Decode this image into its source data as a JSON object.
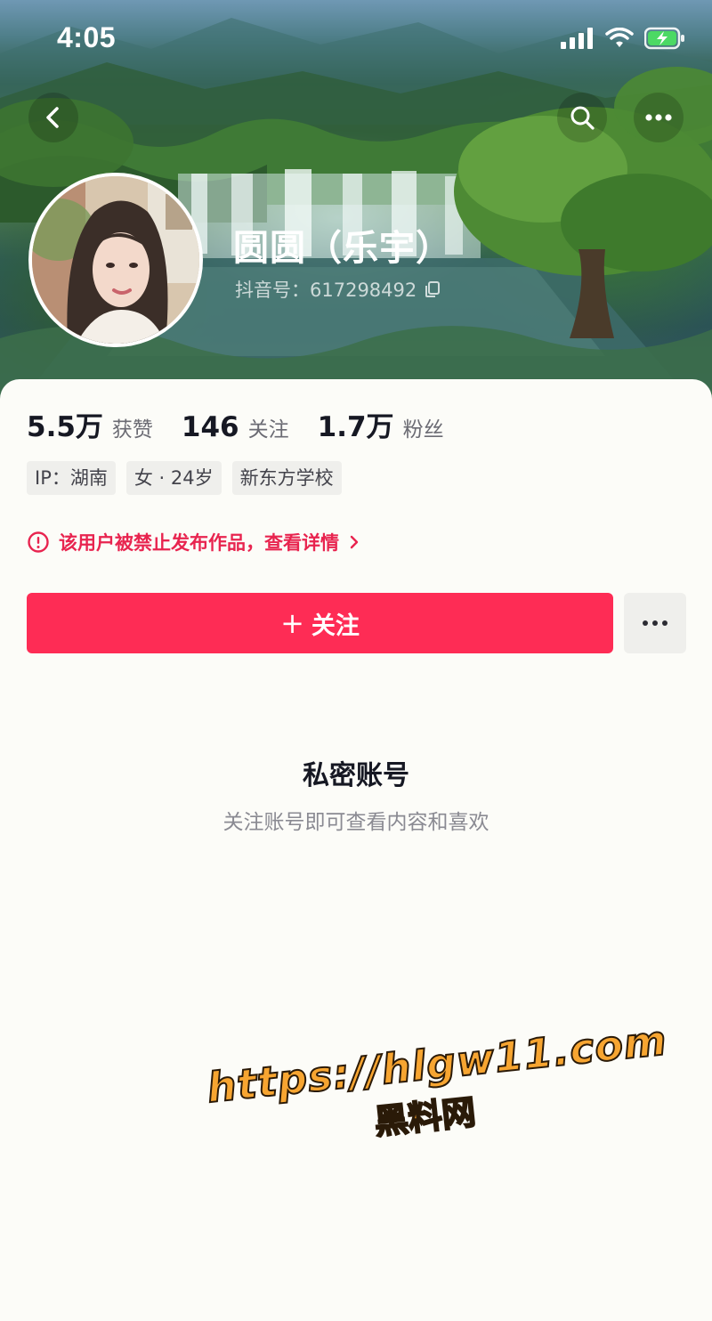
{
  "status_bar": {
    "time": "4:05"
  },
  "header": {
    "back_icon": "chevron-left-icon",
    "search_icon": "search-icon",
    "more_icon": "more-horizontal-icon"
  },
  "profile": {
    "display_name": "圆圆（乐宇）",
    "douyin_id": "抖音号：617298492",
    "copy_icon": "copy-icon"
  },
  "stats": [
    {
      "value": "5.5万",
      "label": "获赞"
    },
    {
      "value": "146",
      "label": "关注"
    },
    {
      "value": "1.7万",
      "label": "粉丝"
    }
  ],
  "tags": [
    "IP：湖南",
    "女 · 24岁",
    "新东方学校"
  ],
  "ban_notice": {
    "text": "该用户被禁止发布作品，查看详情",
    "color": "#e8244f"
  },
  "actions": {
    "follow_label": "关注",
    "follow_color": "#fe2c55"
  },
  "private_account": {
    "title": "私密账号",
    "subtitle": "关注账号即可查看内容和喜欢"
  },
  "watermark": {
    "url": "https://hlgw11.com",
    "site_name": "黑料网"
  }
}
